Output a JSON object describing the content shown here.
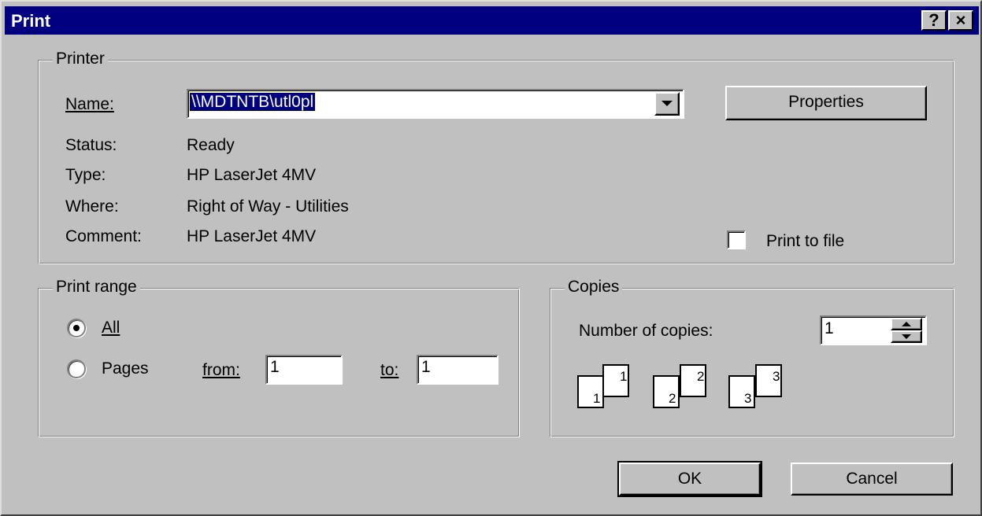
{
  "window": {
    "title": "Print",
    "help_label": "?",
    "close_label": "×"
  },
  "printer": {
    "group_label": "Printer",
    "name_label": "Name:",
    "name_value": "\\\\MDTNTB\\utl0pl",
    "properties_label": "Properties",
    "status_label": "Status:",
    "status_value": "Ready",
    "type_label": "Type:",
    "type_value": "HP LaserJet 4MV",
    "where_label": "Where:",
    "where_value": "Right of Way - Utilities",
    "comment_label": "Comment:",
    "comment_value": "HP LaserJet 4MV",
    "print_to_file_label": "Print to file",
    "print_to_file_checked": false
  },
  "print_range": {
    "group_label": "Print range",
    "all_label": "All",
    "pages_label": "Pages",
    "selected": "All",
    "from_label": "from:",
    "from_value": "1",
    "to_label": "to:",
    "to_value": "1"
  },
  "copies": {
    "group_label": "Copies",
    "number_label": "Number of copies:",
    "number_value": "1",
    "collate_pages": [
      "1",
      "1",
      "2",
      "2",
      "3",
      "3"
    ]
  },
  "buttons": {
    "ok_label": "OK",
    "cancel_label": "Cancel"
  },
  "colors": {
    "titlebar": "#000080",
    "face": "#c0c0c0",
    "selection": "#000080"
  }
}
